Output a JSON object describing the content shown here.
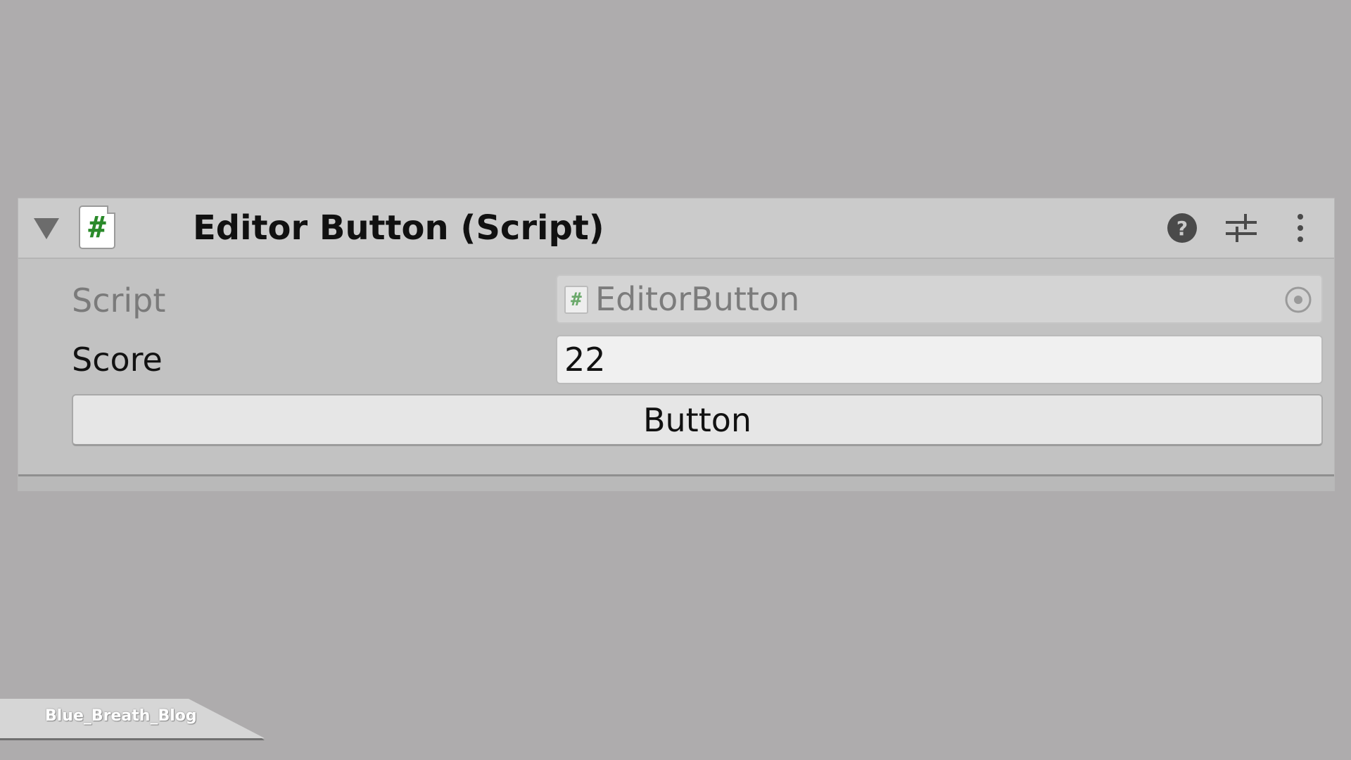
{
  "component": {
    "title": "Editor Button (Script)",
    "script_icon_glyph": "#",
    "header_icons": {
      "help": "help-icon",
      "presets": "presets-icon",
      "menu": "context-menu-icon"
    }
  },
  "fields": {
    "script": {
      "label": "Script",
      "value": "EditorButton",
      "icon_glyph": "#"
    },
    "score": {
      "label": "Score",
      "value": "22"
    }
  },
  "button": {
    "label": "Button"
  },
  "watermark": {
    "text": "Blue_Breath_Blog"
  },
  "colors": {
    "background": "#aeacad",
    "header": "#cbcbcb",
    "body": "#c2c2c2",
    "script_icon_green": "#2a8a2a"
  }
}
